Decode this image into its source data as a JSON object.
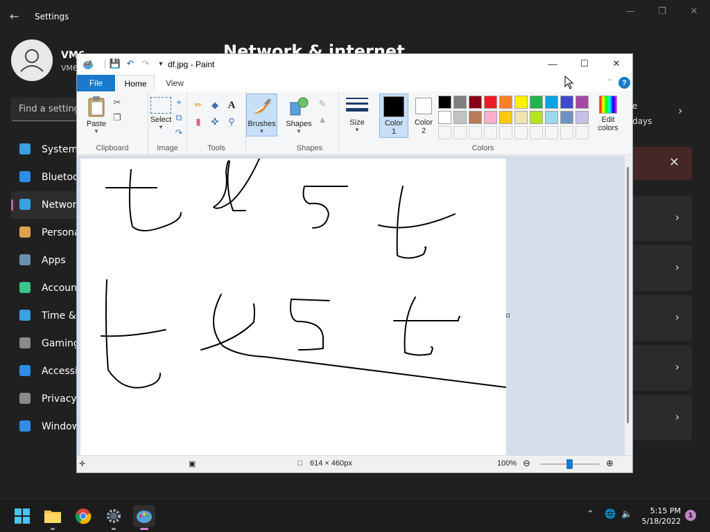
{
  "settings": {
    "title": "Settings",
    "heading": "Network & internet",
    "user_name": "VM6",
    "user_sub": "VM6",
    "search_placeholder": "Find a setting",
    "nav": [
      {
        "label": "System",
        "color": "#3aa0e0"
      },
      {
        "label": "Bluetooth & devices",
        "color": "#2f8de6"
      },
      {
        "label": "Network & internet",
        "color": "#3aa0e0"
      },
      {
        "label": "Personalization",
        "color": "#e0a050"
      },
      {
        "label": "Apps",
        "color": "#6c8fb0"
      },
      {
        "label": "Accounts",
        "color": "#3ec48a"
      },
      {
        "label": "Time & language",
        "color": "#3aa0e0"
      },
      {
        "label": "Gaming",
        "color": "#8a8a8a"
      },
      {
        "label": "Accessibility",
        "color": "#2f8de6"
      },
      {
        "label": "Privacy & security",
        "color": "#8a8a8a"
      },
      {
        "label": "Windows Update",
        "color": "#2f8de6"
      }
    ],
    "card_top_text": "e",
    "card_top_text2": "days"
  },
  "paint": {
    "doc_title": "df.jpg - Paint",
    "tabs": {
      "file": "File",
      "home": "Home",
      "view": "View"
    },
    "groups": {
      "clipboard": "Clipboard",
      "image": "Image",
      "tools": "Tools",
      "shapes": "Shapes",
      "colors": "Colors"
    },
    "buttons": {
      "paste": "Paste",
      "select": "Select",
      "brushes": "Brushes",
      "shapes": "Shapes",
      "size": "Size",
      "color1": "Color",
      "color1_num": "1",
      "color2": "Color",
      "color2_num": "2",
      "edit_colors_1": "Edit",
      "edit_colors_2": "colors"
    },
    "color1_value": "#000000",
    "color2_value": "#ffffff",
    "palette": [
      "#000000",
      "#7f7f7f",
      "#880015",
      "#ed1c24",
      "#ff7f27",
      "#fff200",
      "#22b14c",
      "#00a2e8",
      "#3f48cc",
      "#a349a4",
      "#ffffff",
      "#c3c3c3",
      "#b97a57",
      "#ffaec9",
      "#ffc90e",
      "#efe4b0",
      "#b5e61d",
      "#99d9ea",
      "#7092be",
      "#c8bfe7"
    ],
    "status": {
      "dimensions": "614 × 460px",
      "zoom": "100%"
    }
  },
  "taskbar": {
    "time": "5:15 PM",
    "date": "5/18/2022",
    "notifications": "1"
  }
}
